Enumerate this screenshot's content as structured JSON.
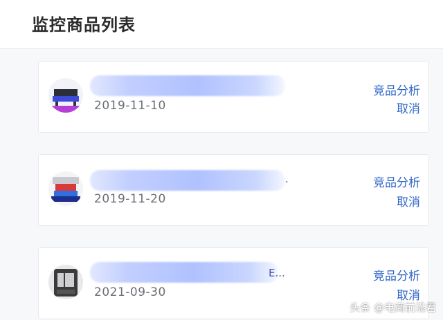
{
  "header": {
    "title": "监控商品列表"
  },
  "products": [
    {
      "name_tail": "",
      "date": "2019-11-10",
      "analyze_label": "竞品分析",
      "cancel_label": "取消"
    },
    {
      "name_tail": ".",
      "date": "2019-11-20",
      "analyze_label": "竞品分析",
      "cancel_label": "取消"
    },
    {
      "name_tail": "E...",
      "date": "2021-09-30",
      "analyze_label": "竞品分析",
      "cancel_label": "取消"
    }
  ],
  "watermark": "头条 @电商前沿君",
  "colors": {
    "link": "#2f66c8",
    "title": "#2b2b2b",
    "date": "#6c6f75"
  }
}
